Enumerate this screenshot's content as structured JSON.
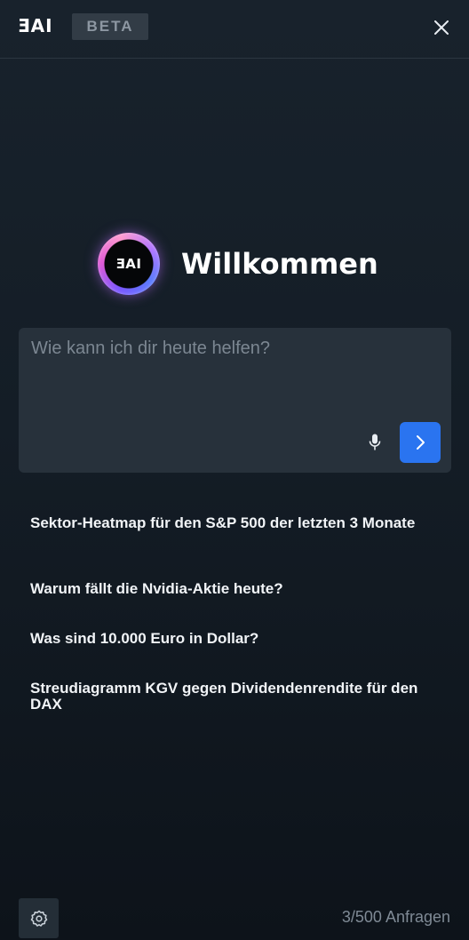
{
  "header": {
    "brand": "ƎAI",
    "badge": "BETA"
  },
  "welcome": {
    "logo_text": "ƎAI",
    "title": "Willkommen"
  },
  "prompt": {
    "placeholder": "Wie kann ich dir heute helfen?",
    "value": ""
  },
  "suggestions": [
    "Sektor-Heatmap für den S&P 500 der letzten 3 Monate",
    "Warum fällt die Nvidia-Aktie heute?",
    "Was sind 10.000 Euro in Dollar?",
    "Streudiagramm KGV gegen Dividendenrendite für den DAX"
  ],
  "footer": {
    "usage": "3/500 Anfragen"
  },
  "icons": {
    "close": "close-icon",
    "mic": "microphone-icon",
    "send": "chevron-right-icon",
    "settings": "gear-icon"
  },
  "colors": {
    "background": "#141d26",
    "accent": "#2a74f0",
    "badge_bg": "#323c46",
    "input_bg": "#27313b"
  }
}
